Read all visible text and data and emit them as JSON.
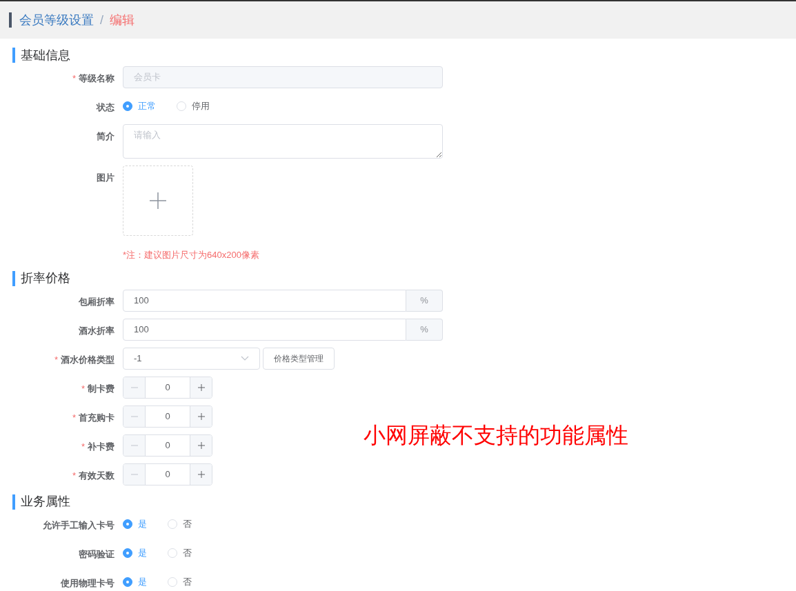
{
  "breadcrumb": [
    {
      "label": "会员等级设置",
      "current": false
    },
    {
      "label": "编辑",
      "current": true
    }
  ],
  "breadcrumb_separator": "/",
  "required_mark": "*",
  "sections": [
    {
      "title": "基础信息",
      "fields": [
        {
          "kind": "text",
          "label": "等级名称",
          "required": true,
          "value": "会员卡",
          "disabled": true
        },
        {
          "kind": "radio",
          "label": "状态",
          "required": false,
          "options": [
            {
              "label": "正常",
              "selected": true
            },
            {
              "label": "停用",
              "selected": false
            }
          ]
        },
        {
          "kind": "textarea",
          "label": "简介",
          "required": false,
          "placeholder": "请输入"
        },
        {
          "kind": "upload",
          "label": "图片",
          "required": false,
          "note": "*注：建议图片尺寸为640x200像素"
        }
      ]
    },
    {
      "title": "折率价格",
      "fields": [
        {
          "kind": "addon",
          "label": "包厢折率",
          "required": false,
          "value": "100",
          "suffix": "%"
        },
        {
          "kind": "addon",
          "label": "酒水折率",
          "required": false,
          "value": "100",
          "suffix": "%"
        },
        {
          "kind": "select",
          "label": "酒水价格类型",
          "required": true,
          "value": "-1",
          "button": "价格类型管理"
        },
        {
          "kind": "stepper",
          "label": "制卡费",
          "required": true,
          "value": "0"
        },
        {
          "kind": "stepper",
          "label": "首充购卡",
          "required": true,
          "value": "0"
        },
        {
          "kind": "stepper",
          "label": "补卡费",
          "required": true,
          "value": "0"
        },
        {
          "kind": "stepper",
          "label": "有效天数",
          "required": true,
          "value": "0"
        }
      ]
    },
    {
      "title": "业务属性",
      "fields": [
        {
          "kind": "radio",
          "label": "允许手工输入卡号",
          "required": false,
          "options": [
            {
              "label": "是",
              "selected": true
            },
            {
              "label": "否",
              "selected": false
            }
          ]
        },
        {
          "kind": "radio",
          "label": "密码验证",
          "required": false,
          "options": [
            {
              "label": "是",
              "selected": true
            },
            {
              "label": "否",
              "selected": false
            }
          ]
        },
        {
          "kind": "radio",
          "label": "使用物理卡号",
          "required": false,
          "options": [
            {
              "label": "是",
              "selected": true
            },
            {
              "label": "否",
              "selected": false
            }
          ]
        }
      ]
    }
  ],
  "annotation": "小网屏蔽不支持的功能属性"
}
